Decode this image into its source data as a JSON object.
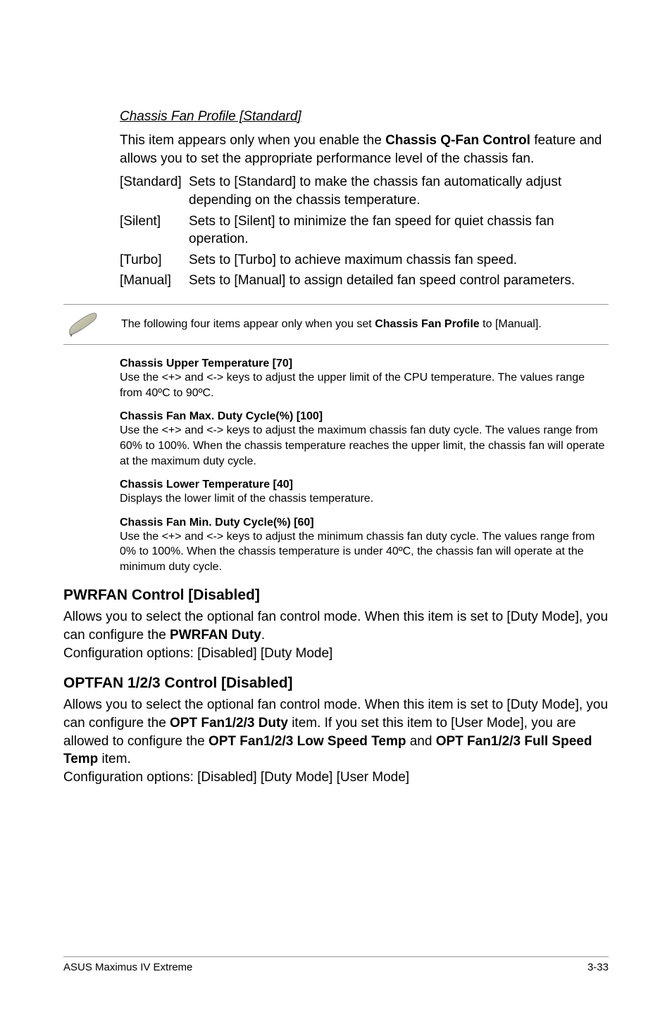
{
  "section1": {
    "title": "Chassis Fan Profile [Standard]",
    "intro_part1": "This item appears only when you enable the ",
    "intro_bold": "Chassis Q-Fan Control",
    "intro_part2": " feature and allows you to set the appropriate performance level of the chassis fan.",
    "opts": {
      "standard_label": "[Standard]",
      "standard_desc": "Sets to [Standard] to make the chassis fan automatically adjust depending on the chassis temperature.",
      "silent_label": "[Silent]",
      "silent_desc": "Sets to [Silent] to minimize the fan speed for quiet chassis fan operation.",
      "turbo_label": "[Turbo]",
      "turbo_desc": "Sets to [Turbo] to achieve maximum chassis fan speed.",
      "manual_label": "[Manual]",
      "manual_desc": "Sets to [Manual] to assign detailed fan speed control parameters."
    }
  },
  "note": {
    "part1": "The following four items appear only when you set ",
    "bold": "Chassis Fan Profile",
    "part2": " to [Manual]."
  },
  "subs": {
    "s1_title": "Chassis Upper Temperature [70]",
    "s1_body": "Use the <+> and <-> keys to adjust the upper limit of the CPU temperature. The values range from 40ºC to 90ºC.",
    "s2_title": "Chassis Fan Max. Duty Cycle(%) [100]",
    "s2_body": "Use the <+> and <-> keys to adjust the maximum chassis fan duty cycle. The values range from 60% to 100%. When the chassis temperature reaches the upper limit, the chassis fan will operate at the maximum duty cycle.",
    "s3_title": "Chassis Lower Temperature [40]",
    "s3_body": "Displays the lower limit of the chassis temperature.",
    "s4_title": "Chassis Fan Min. Duty Cycle(%) [60]",
    "s4_body": "Use the <+> and <-> keys to adjust the minimum chassis fan duty cycle. The values range from 0% to 100%. When the chassis temperature is under 40ºC, the chassis fan will operate at the minimum duty cycle."
  },
  "pwrfan": {
    "heading": "PWRFAN Control [Disabled]",
    "body_part1": "Allows you to select the optional fan control mode. When this item is set to [Duty Mode], you can configure the ",
    "body_bold": "PWRFAN Duty",
    "body_part2": ".",
    "config": "Configuration options: [Disabled] [Duty Mode]"
  },
  "optfan": {
    "heading": "OPTFAN 1/2/3 Control [Disabled]",
    "body_part1": "Allows you to select the optional fan control mode. When this item is set to [Duty Mode], you can configure the ",
    "body_bold1": "OPT Fan1/2/3 Duty",
    "body_part2": " item. If you set this item to [User Mode], you are allowed to configure the ",
    "body_bold2": "OPT Fan1/2/3 Low Speed Temp",
    "body_part3": " and ",
    "body_bold3": "OPT Fan1/2/3 Full Speed Temp",
    "body_part4": " item.",
    "config": "Configuration options: [Disabled] [Duty Mode] [User Mode]"
  },
  "footer": {
    "left": "ASUS Maximus IV Extreme",
    "right": "3-33"
  }
}
